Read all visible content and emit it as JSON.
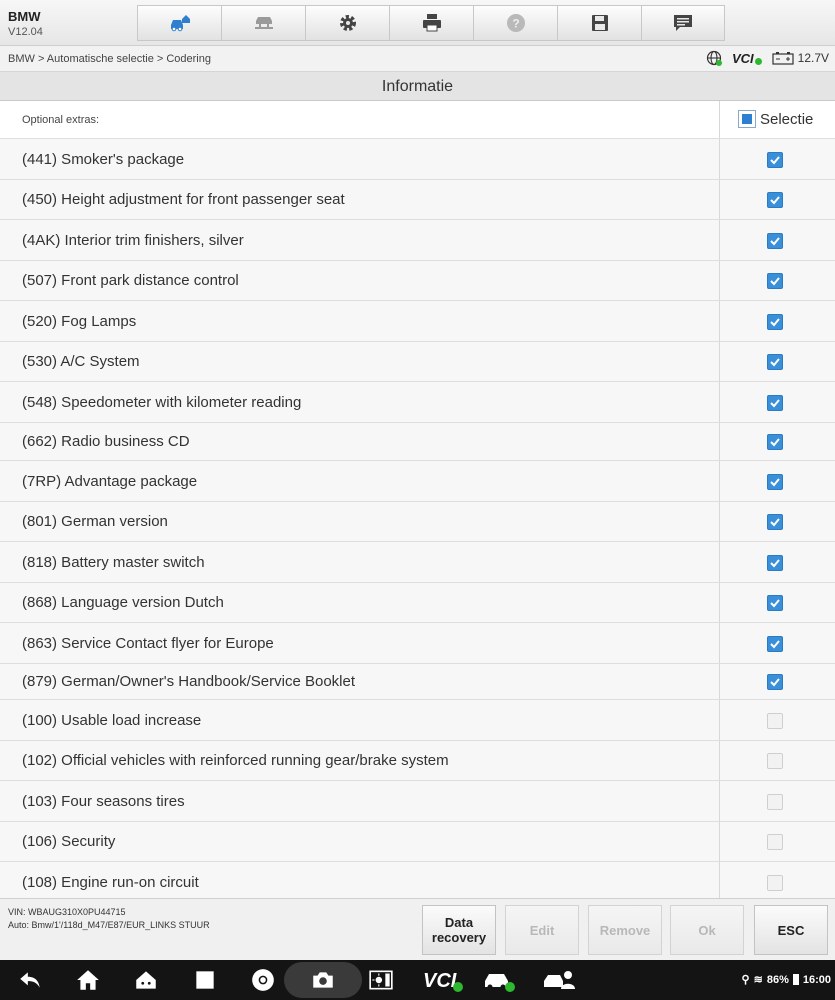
{
  "app": {
    "name": "BMW",
    "version": "V12.04"
  },
  "toolbar": {
    "tools": [
      {
        "icon": "vehicle-home-icon"
      },
      {
        "icon": "car-lift-icon"
      },
      {
        "icon": "gear-icon"
      },
      {
        "icon": "printer-icon"
      },
      {
        "icon": "help-icon"
      },
      {
        "icon": "save-icon"
      },
      {
        "icon": "message-icon"
      }
    ]
  },
  "breadcrumb": "BMW > Automatische selectie > Codering",
  "status": {
    "vci_label": "VCI",
    "voltage": "12.7V"
  },
  "title": "Informatie",
  "table": {
    "header_label": "Optional extras:",
    "select_label": "Selectie",
    "rows": [
      {
        "label": "(441) Smoker's package",
        "checked": true
      },
      {
        "label": "(450) Height adjustment for front passenger seat",
        "checked": true
      },
      {
        "label": "(4AK) Interior trim finishers, silver",
        "checked": true
      },
      {
        "label": "(507) Front park distance control",
        "checked": true
      },
      {
        "label": "(520) Fog Lamps",
        "checked": true
      },
      {
        "label": "(530) A/C System",
        "checked": true
      },
      {
        "label": "(548) Speedometer with kilometer reading",
        "checked": true
      },
      {
        "label": "(662) Radio business CD",
        "checked": true
      },
      {
        "label": "(7RP) Advantage package",
        "checked": true
      },
      {
        "label": "(801) German version",
        "checked": true
      },
      {
        "label": "(818) Battery master switch",
        "checked": true
      },
      {
        "label": "(868) Language version Dutch",
        "checked": true
      },
      {
        "label": "(863) Service Contact flyer for Europe",
        "checked": true
      },
      {
        "label": "(879) German/Owner's Handbook/Service Booklet",
        "checked": true
      },
      {
        "label": "(100) Usable load increase",
        "checked": false
      },
      {
        "label": "(102) Official vehicles with reinforced running gear/brake system",
        "checked": false
      },
      {
        "label": "(103) Four seasons tires",
        "checked": false
      },
      {
        "label": "(106) Security",
        "checked": false
      },
      {
        "label": "(108) Engine run-on circuit",
        "checked": false
      }
    ]
  },
  "footer": {
    "vin": "VIN: WBAUG310X0PU44715",
    "auto": "Auto: Bmw/1'/118d_M47/E87/EUR_LINKS STUUR",
    "buttons": {
      "data_recovery_line1": "Data",
      "data_recovery_line2": "recovery",
      "edit": "Edit",
      "remove": "Remove",
      "ok": "Ok",
      "esc": "ESC"
    }
  },
  "system_bar": {
    "battery": "86%",
    "time": "16:00"
  },
  "colors": {
    "accent": "#3a8fd9",
    "nav_bg": "#141414"
  }
}
